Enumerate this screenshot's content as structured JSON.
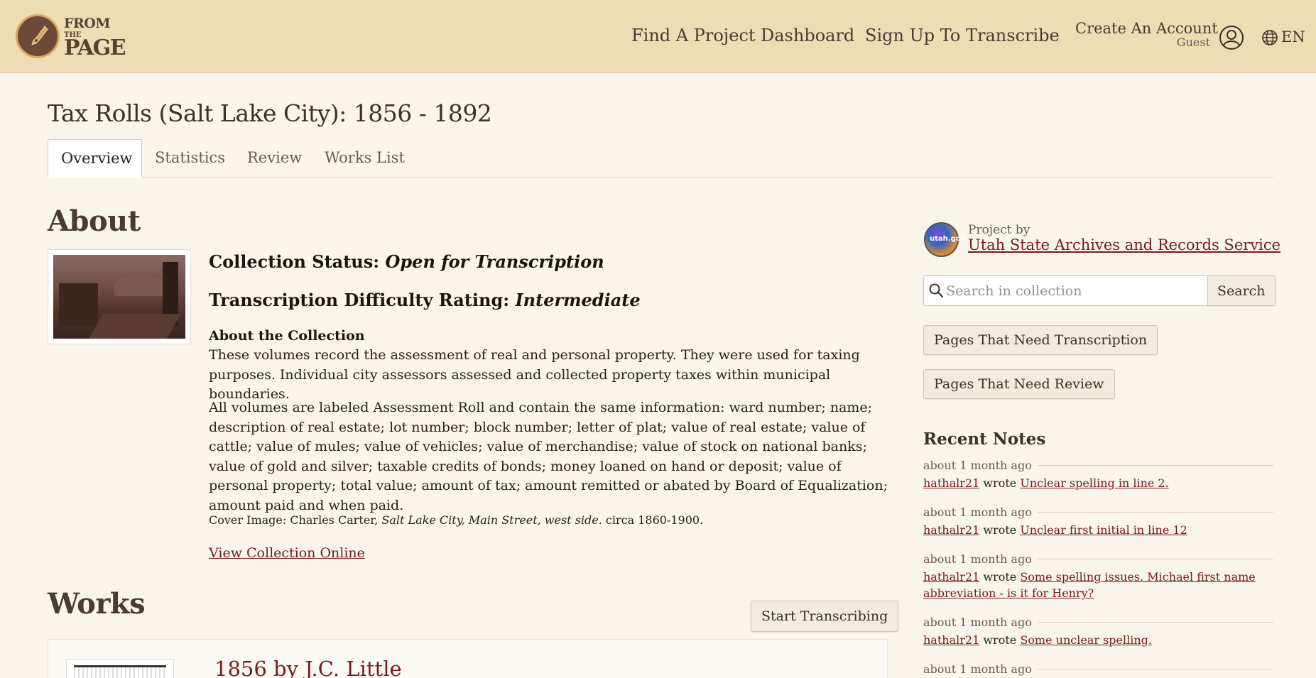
{
  "header": {
    "logo": {
      "line1": "FROM",
      "line2": "THE",
      "line3": "PAGE"
    },
    "nav": {
      "find": "Find A Project",
      "dashboard": "Dashboard",
      "signup": "Sign Up To Transcribe"
    },
    "account": {
      "title": "Create An Account",
      "subtitle": "Guest"
    },
    "language": "EN"
  },
  "page": {
    "title": "Tax Rolls (Salt Lake City): 1856 - 1892",
    "tabs": [
      "Overview",
      "Statistics",
      "Review",
      "Works List"
    ]
  },
  "about": {
    "heading": "About",
    "status_label": "Collection Status:",
    "status_value": "Open for Transcription",
    "difficulty_label": "Transcription Difficulty Rating:",
    "difficulty_value": "Intermediate",
    "collection_heading": "About the Collection",
    "desc1": "These volumes record the assessment of real and personal property. They were used for taxing purposes. Individual city assessors assessed and collected property taxes within municipal boundaries.",
    "desc2": "All volumes are labeled Assessment Roll and contain the same information: ward number; name; description of real estate; lot number; block number; letter of plat; value of real estate; value of cattle; value of mules; value of vehicles; value of merchandise; value of stock on national banks; value of gold and silver; taxable credits of bonds; money loaned on hand or deposit; value of personal property; total value; amount of tax; amount remitted or abated by Board of Equalization; amount paid and when paid.",
    "cover_prefix": "Cover Image: Charles Carter,",
    "cover_title": "Salt Lake City, Main Street, west side.",
    "cover_suffix": "circa 1860-1900.",
    "view_online": "View Collection Online"
  },
  "works": {
    "heading": "Works",
    "start_button": "Start Transcribing",
    "first_work_title": "1856 by J.C. Little"
  },
  "sidebar": {
    "project_by": "Project by",
    "project_name": "Utah State Archives and Records Service",
    "avatar_text": "utah.gov",
    "search_placeholder": "Search in collection",
    "search_button": "Search",
    "need_transcription": "Pages That Need Transcription",
    "need_review": "Pages That Need Review",
    "recent_heading": "Recent Notes",
    "notes": [
      {
        "time": "about 1 month ago",
        "user": "hathalr21",
        "verb": "wrote",
        "text": "Unclear spelling in line 2."
      },
      {
        "time": "about 1 month ago",
        "user": "hathalr21",
        "verb": "wrote",
        "text": "Unclear first initial in line 12"
      },
      {
        "time": "about 1 month ago",
        "user": "hathalr21",
        "verb": "wrote",
        "text": "Some spelling issues. Michael first name abbreviation - is it for Henry?"
      },
      {
        "time": "about 1 month ago",
        "user": "hathalr21",
        "verb": "wrote",
        "text": "Some unclear spelling."
      },
      {
        "time": "about 1 month ago"
      }
    ]
  },
  "colors": {
    "header_bg": "#eedcb5",
    "page_bg": "#f9f5ea",
    "link": "#7a1a1a",
    "text": "#3d2f2a"
  }
}
